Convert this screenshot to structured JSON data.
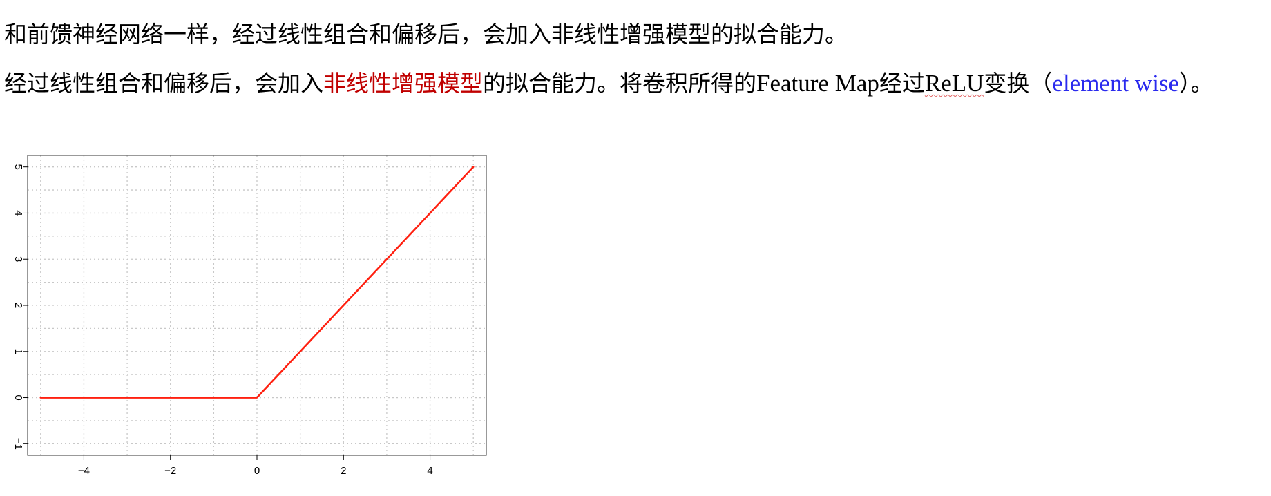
{
  "paragraphs": {
    "line1": "和前馈神经网络一样，经过线性组合和偏移后，会加入非线性增强模型的拟合能力。",
    "line2": {
      "part1": "经过线性组合和偏移后，会加入",
      "highlight": "非线性增强模型",
      "part2": "的拟合能力。将卷积所得的",
      "term_feature_map": "Feature Map",
      "part3": "经过",
      "term_relu": "ReLU",
      "part4": "变换（",
      "term_element_wise": "element wise",
      "part5": "）。"
    }
  },
  "colors": {
    "highlight": "#c00000",
    "link_blue": "#2a2aee",
    "curve": "#ff2010",
    "grid": "#c8c8c8",
    "frame": "#555555"
  },
  "chart_data": {
    "type": "line",
    "title": "",
    "xlabel": "",
    "ylabel": "",
    "xlim": [
      -5.3,
      5.3
    ],
    "ylim": [
      -1.25,
      5.25
    ],
    "x_ticks": [
      -4,
      -2,
      0,
      2,
      4
    ],
    "y_ticks": [
      -1,
      0,
      1,
      2,
      3,
      4,
      5
    ],
    "x_tick_labels": [
      "−4",
      "−2",
      "0",
      "2",
      "4"
    ],
    "y_tick_labels": [
      "−1",
      "0",
      "1",
      "2",
      "3",
      "4",
      "5"
    ],
    "grid": true,
    "grid_style": "dotted",
    "series": [
      {
        "x": [
          -5,
          -4,
          -3,
          -2,
          -1,
          0,
          1,
          2,
          3,
          4,
          5
        ],
        "y": [
          0,
          0,
          0,
          0,
          0,
          0,
          1,
          2,
          3,
          4,
          5
        ]
      }
    ]
  }
}
